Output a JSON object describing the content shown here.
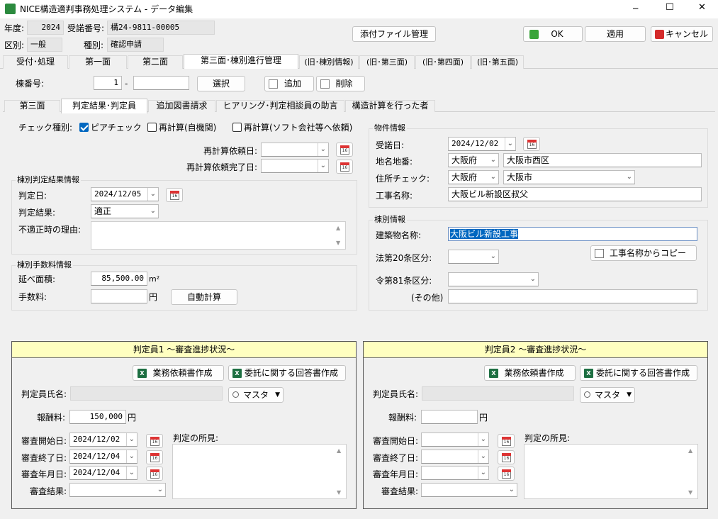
{
  "window": {
    "title": "NICE構造適判事務処理システム - データ編集",
    "minimize": "─",
    "maximize": "☐",
    "close": "✕"
  },
  "header": {
    "year_label": "年度:",
    "year_value": "2024",
    "receipt_label": "受諾番号:",
    "receipt_value": "構24-9811-00005",
    "section_label": "区別:",
    "section_value": "一般",
    "type_label": "種別:",
    "type_value": "確認申請",
    "attach_button": "添付ファイル管理",
    "ok_button": "OK",
    "apply_button": "適用",
    "cancel_button": "キャンセル"
  },
  "main_tabs": [
    "受付･処理",
    "第一面",
    "第二面",
    "第三面･棟別進行管理",
    "(旧･棟別情報)",
    "(旧･第三面)",
    "(旧･第四面)",
    "(旧･第五面)"
  ],
  "building": {
    "label": "棟番号:",
    "number": "1",
    "dash": "-",
    "sub": "",
    "select_button": "選択",
    "add_button": "追加",
    "delete_button": "削除"
  },
  "sub_tabs": [
    "第三面",
    "判定結果･判定員",
    "追加図書請求",
    "ヒアリング･判定相談員の助言",
    "構造計算を行った者"
  ],
  "check": {
    "label": "チェック種別:",
    "options": [
      {
        "label": "ピアチェック",
        "checked": true
      },
      {
        "label": "再計算(自機関)",
        "checked": false
      },
      {
        "label": "再計算(ソフト会社等へ依頼)",
        "checked": false
      }
    ],
    "recalc_request_label": "再計算依頼日:",
    "recalc_request_value": "",
    "recalc_done_label": "再計算依頼完了日:",
    "recalc_done_value": ""
  },
  "result": {
    "group_label": "棟別判定結果情報",
    "date_label": "判定日:",
    "date_value": "2024/12/05",
    "result_label": "判定結果:",
    "result_value": "適正",
    "reason_label": "不適正時の理由:",
    "reason_value": ""
  },
  "fee": {
    "group_label": "棟別手数料情報",
    "area_label": "延べ面積:",
    "area_value": "85,500.00",
    "area_unit": "m²",
    "fee_label": "手数料:",
    "fee_value": "",
    "fee_unit": "円",
    "auto_calc_button": "自動計算"
  },
  "property": {
    "group_label": "物件情報",
    "receipt_date_label": "受諾日:",
    "receipt_date_value": "2024/12/02",
    "address_label": "地名地番:",
    "address_pref": "大阪府",
    "address_value": "大阪市西区",
    "addr_check_label": "住所チェック:",
    "addr_check_pref": "大阪府",
    "addr_check_city": "大阪市",
    "work_name_label": "工事名称:",
    "work_name_value": "大阪ビル新設区叔父"
  },
  "building_info": {
    "group_label": "棟別情報",
    "name_label": "建築物名称:",
    "name_value": "大阪ビル新設工事",
    "art20_label": "法第20条区分:",
    "art20_value": "",
    "copy_button": "工事名称からコピー",
    "art81_label": "令第81条区分:",
    "art81_value": "",
    "other_label": "(その他)",
    "other_value": ""
  },
  "judges": [
    {
      "title": "判定員1 ～審査進捗状況～",
      "request_button": "業務依頼書作成",
      "reply_button": "委託に関する回答書作成",
      "name_label": "判定員氏名:",
      "name_value": "",
      "master_button": "マスタ",
      "pay_label": "報酬料:",
      "pay_value": "150,000",
      "pay_unit": "円",
      "start_label": "審査開始日:",
      "start_value": "2024/12/02",
      "end_label": "審査終了日:",
      "end_value": "2024/12/04",
      "ym_label": "審査年月日:",
      "ym_value": "2024/12/04",
      "result_label": "審査結果:",
      "result_value": "",
      "opinion_label": "判定の所見:",
      "opinion_value": ""
    },
    {
      "title": "判定員2 ～審査進捗状況～",
      "request_button": "業務依頼書作成",
      "reply_button": "委託に関する回答書作成",
      "name_label": "判定員氏名:",
      "name_value": "",
      "master_button": "マスタ",
      "pay_label": "報酬料:",
      "pay_value": "",
      "pay_unit": "円",
      "start_label": "審査開始日:",
      "start_value": "",
      "end_label": "審査終了日:",
      "end_value": "",
      "ym_label": "審査年月日:",
      "ym_value": "",
      "result_label": "審査結果:",
      "result_value": "",
      "opinion_label": "判定の所見:",
      "opinion_value": ""
    }
  ],
  "calendar_icon_text": "16",
  "colors": {
    "panel_header": "#ffffc0",
    "checkbox_accent": "#0067c0",
    "selection": "#0067c0",
    "cancel_red": "#d42a2a",
    "ok_green": "#3aa53a",
    "excel_green": "#1d6f42"
  }
}
